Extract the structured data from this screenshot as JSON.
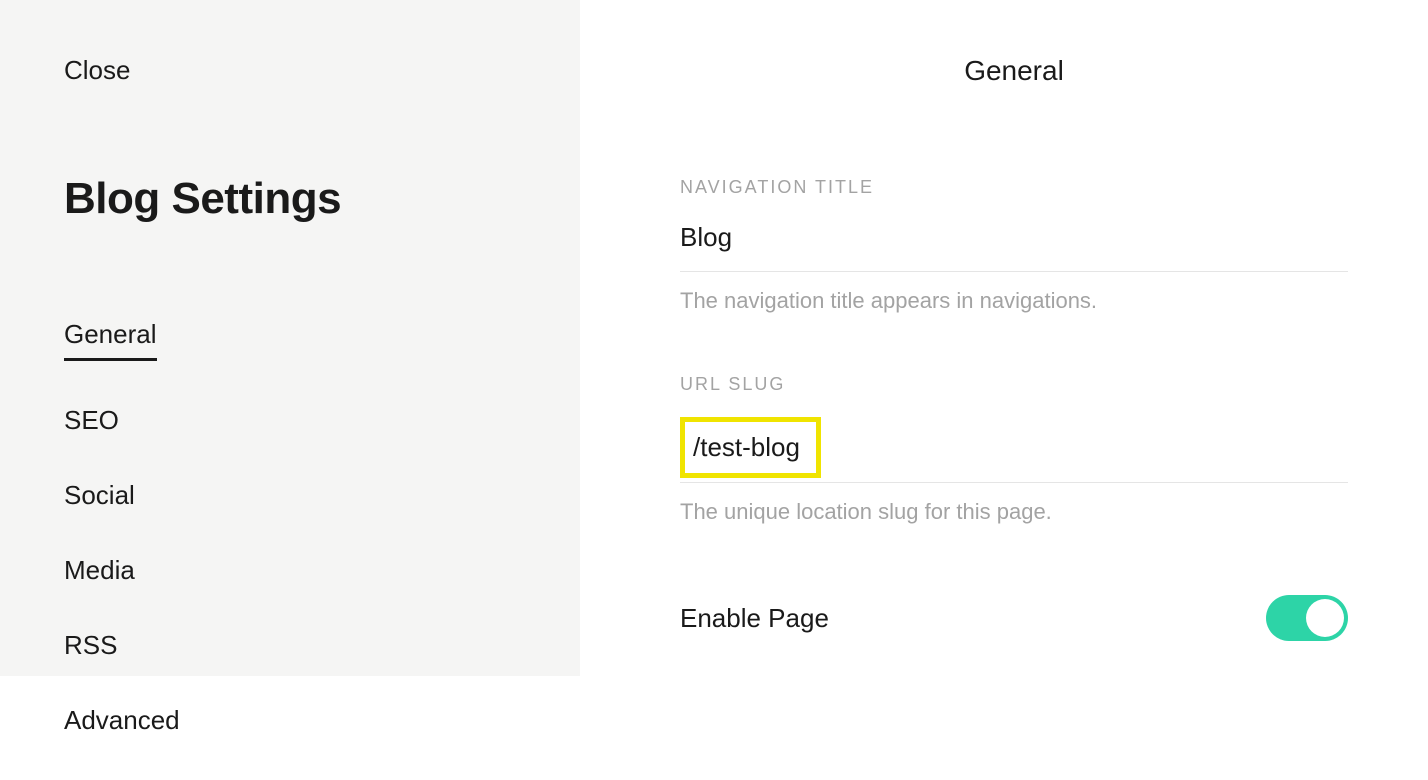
{
  "sidebar": {
    "close_label": "Close",
    "title": "Blog Settings",
    "nav_items": [
      {
        "label": "General",
        "active": true
      },
      {
        "label": "SEO",
        "active": false
      },
      {
        "label": "Social",
        "active": false
      },
      {
        "label": "Media",
        "active": false
      },
      {
        "label": "RSS",
        "active": false
      },
      {
        "label": "Advanced",
        "active": false
      }
    ]
  },
  "main": {
    "header": "General",
    "navigation_title": {
      "label": "NAVIGATION TITLE",
      "value": "Blog",
      "description": "The navigation title appears in navigations."
    },
    "url_slug": {
      "label": "URL SLUG",
      "value": "/test-blog",
      "description": "The unique location slug for this page."
    },
    "enable_page": {
      "label": "Enable Page",
      "enabled": true
    }
  }
}
